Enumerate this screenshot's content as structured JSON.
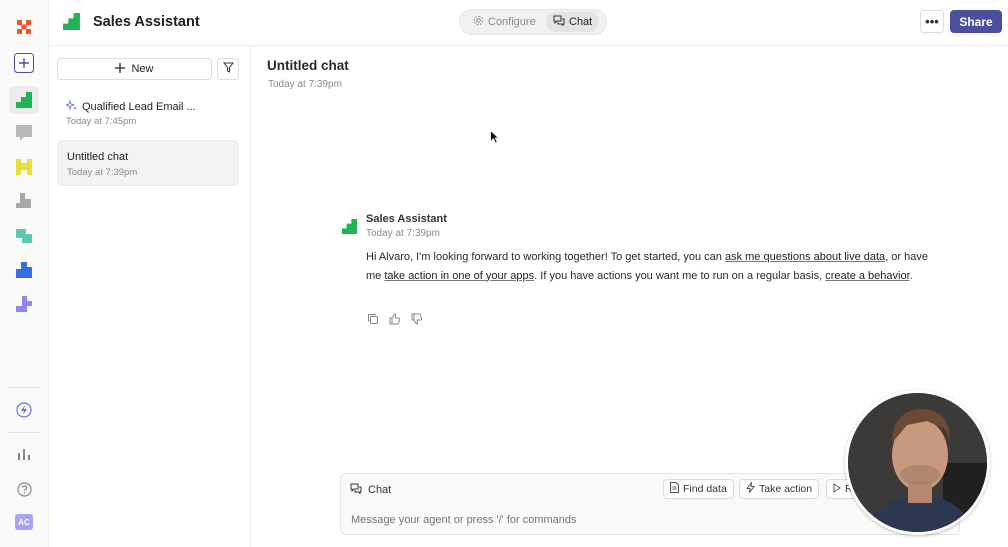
{
  "app": {
    "title": "Sales Assistant",
    "brand_color": "#22b357",
    "accent_color": "#4a4f9e"
  },
  "rail": {
    "avatar_initials": "AC",
    "icons": [
      "x-logo-icon",
      "plus-icon",
      "agent-green-icon",
      "agent-gray-icon",
      "agent-yellow-icon",
      "agent-stairs-icon",
      "agent-teal-icon",
      "agent-blue-icon",
      "agent-purple-icon",
      "bolt-icon",
      "bar-chart-icon",
      "help-icon"
    ]
  },
  "header": {
    "tabs": [
      {
        "label": "Configure",
        "icon": "gear-icon",
        "active": false
      },
      {
        "label": "Chat",
        "icon": "chat-bubbles-icon",
        "active": true
      }
    ],
    "more_label": "•••",
    "share_label": "Share"
  },
  "sidebar": {
    "new_label": "New",
    "chats": [
      {
        "title": "Qualified Lead Email ...",
        "time": "Today at 7:45pm",
        "icon": "sparkle-icon",
        "active": false
      },
      {
        "title": "Untitled chat",
        "time": "Today at 7:39pm",
        "active": true
      }
    ]
  },
  "main": {
    "title": "Untitled chat",
    "time": "Today at 7:39pm",
    "message": {
      "sender": "Sales Assistant",
      "time": "Today at 7:39pm",
      "part1": "Hi Alvaro, I'm looking forward to working together! To get started, you can ",
      "link1": "ask me questions about live data",
      "part2": ", or have me ",
      "link2": "take action in one of your apps",
      "part3": ". If you have actions you want me to run on a regular basis, ",
      "link3": "create a behavior",
      "part4": "."
    }
  },
  "composer": {
    "label": "Chat",
    "find_data": "Find data",
    "take_action": "Take action",
    "third_chip": "R",
    "placeholder": "Message your agent or press '/' for commands"
  }
}
